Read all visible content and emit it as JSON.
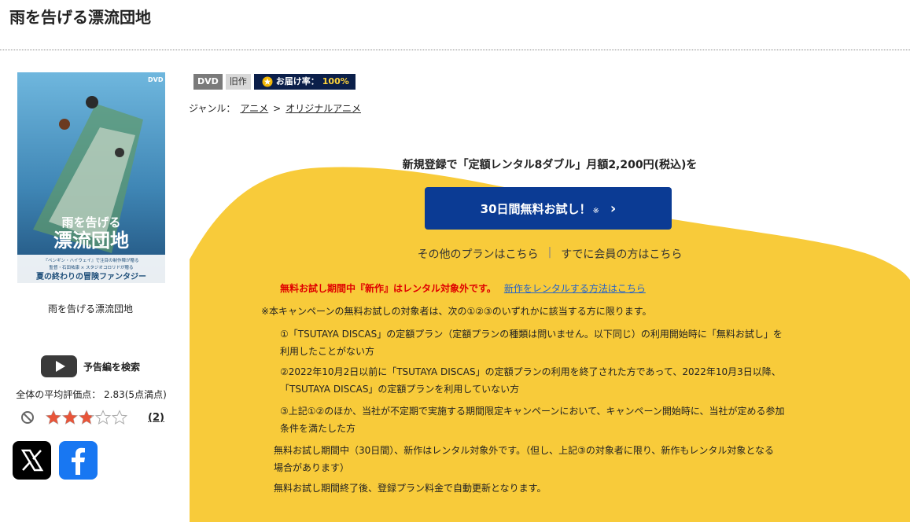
{
  "title": "雨を告げる漂流団地",
  "cover": {
    "dvd_mark": "DVD",
    "title_line1": "雨を告げる",
    "title_line2": "漂流団地",
    "sub1": "『ペンギン・ハイウェイ』で注目の制作陣が贈る",
    "sub2": "監督・石田祐康 × スタジオコロリドが贈る",
    "tagline": "夏の終わりの冒険ファンタジー",
    "caption": "雨を告げる漂流団地"
  },
  "trailer": {
    "label": "予告編を検索"
  },
  "rating": {
    "text": "全体の平均評価点： 2.83(5点満点)",
    "value": 2.83,
    "max": 5,
    "count": "(2)"
  },
  "badges": {
    "dvd": "DVD",
    "old": "旧作",
    "delivery_label": "お届け率：",
    "delivery_rate": "100%"
  },
  "genre": {
    "label": "ジャンル：",
    "path": [
      "アニメ",
      "オリジナルアニメ"
    ],
    "sep": ">"
  },
  "campaign": {
    "lead": "新規登録で「定額レンタル8ダブル」月額2,200円(税込)を",
    "cta": "30日間無料お試し！",
    "cta_note": "※",
    "other_plans": "その他のプランはこちら",
    "divider": "|",
    "member": "すでに会員の方はこちら"
  },
  "notice": {
    "red": "無料お試し期間中『新作』はレンタル対象外です。",
    "link": "新作をレンタルする方法はこちら"
  },
  "conditions": {
    "head": "※本キャンペーンの無料お試しの対象者は、次の①②③のいずれかに該当する方に限ります。",
    "c1_a": "①「TSUTAYA DISCAS」の定額プラン（定額プランの種類は問いません。以下同じ）の利用開始時に「無料お試し」を",
    "c1_b": "利用したことがない方",
    "c2_a": "②2022年10月2日以前に「TSUTAYA DISCAS」の定額プランの利用を終了された方であって、2022年10月3日以降、",
    "c2_b": "「TSUTAYA DISCAS」の定額プランを利用していない方",
    "c3_a": "③上記①②のほか、当社が不定期で実施する期間限定キャンペーンにおいて、キャンペーン開始時に、当社が定める参加",
    "c3_b": "条件を満たした方",
    "p1_a": "無料お試し期間中（30日間）、新作はレンタル対象外です。（但し、上記③の対象者に限り、新作もレンタル対象となる",
    "p1_b": "場合があります）",
    "p2": "無料お試し期間終了後、登録プラン料金で自動更新となります。"
  },
  "colors": {
    "yellow": "#f8cb3a",
    "cta_blue": "#0b3b94",
    "badge_navy": "#0b1f4a",
    "red": "#e00000",
    "star": "#e8553a"
  },
  "icons": {
    "trailer": "youtube-play-icon",
    "not_interested": "no-entry-icon",
    "star": "star-icon",
    "x": "x-logo-icon",
    "facebook": "facebook-logo-icon",
    "medal": "medal-icon"
  }
}
